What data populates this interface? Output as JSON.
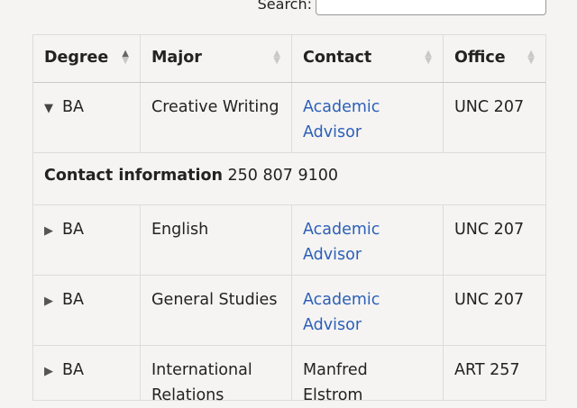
{
  "search": {
    "label": "Search:",
    "value": ""
  },
  "table": {
    "headers": [
      "Degree",
      "Major",
      "Contact",
      "Office"
    ],
    "rows": [
      {
        "degree": "BA",
        "major": "Creative Writing",
        "contact": "Academic Advisor",
        "office": "UNC 207",
        "expanded": true
      },
      {
        "degree": "BA",
        "major": "English",
        "contact": "Academic Advisor",
        "office": "UNC 207",
        "expanded": false
      },
      {
        "degree": "BA",
        "major": "General Studies",
        "contact": "Academic Advisor",
        "office": "UNC 207",
        "expanded": false
      },
      {
        "degree": "BA",
        "major": "International Relations",
        "contact": "Manfred Elstrom",
        "office": "ART 257",
        "expanded": false
      }
    ],
    "detail": {
      "label": "Contact information",
      "value": "250 807 9100"
    }
  },
  "icons": {
    "expanded": "triangle-down-icon",
    "collapsed": "triangle-right-icon",
    "sort_active": "sort-ascending-icon",
    "sort_inactive": "sort-both-icon"
  },
  "colors": {
    "link": "#2c5fb8",
    "background": "#f5f4f2"
  }
}
